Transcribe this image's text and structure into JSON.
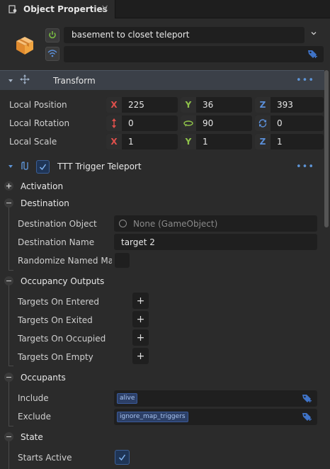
{
  "tab": {
    "title": "Object Properties",
    "close": "×"
  },
  "object": {
    "name": "basement to closet teleport",
    "tag_value": ""
  },
  "transform": {
    "title": "Transform",
    "position": {
      "label": "Local Position",
      "x": "225",
      "y": "36",
      "z": "393"
    },
    "rotation": {
      "label": "Local Rotation",
      "a": "0",
      "b": "90",
      "c": "0"
    },
    "scale": {
      "label": "Local Scale",
      "x": "1",
      "y": "1",
      "z": "1"
    },
    "axis": {
      "x": "X",
      "y": "Y",
      "z": "Z"
    }
  },
  "component": {
    "title": "TTT Trigger Teleport",
    "activation": "Activation",
    "destination": {
      "title": "Destination",
      "object_label": "Destination Object",
      "object_value": "None (GameObject)",
      "name_label": "Destination Name",
      "name_value": "target 2",
      "randomize_label": "Randomize Named Match"
    },
    "occupancy_outputs": {
      "title": "Occupancy Outputs",
      "entered": "Targets On Entered",
      "exited": "Targets On Exited",
      "occupied": "Targets On Occupied",
      "empty": "Targets On Empty",
      "plus": "+"
    },
    "occupants": {
      "title": "Occupants",
      "include_label": "Include",
      "include_tag": "alive",
      "exclude_label": "Exclude",
      "exclude_tag": "ignore_map_triggers"
    },
    "state": {
      "title": "State",
      "starts_active_label": "Starts Active",
      "starts_active": true
    }
  },
  "colors": {
    "accent": "#5d94d6",
    "x_axis": "#e0504c",
    "y_axis": "#8fc24a",
    "z_axis": "#5b8fd9",
    "enable_green": "#7cc242"
  }
}
